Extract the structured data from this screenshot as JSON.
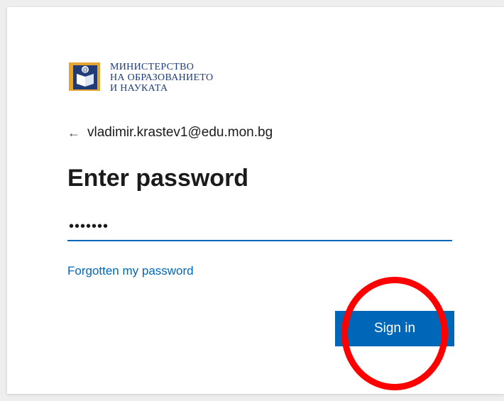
{
  "logo": {
    "line1": "МИНИСТЕРСТВО",
    "line2": "НА ОБРАЗОВАНИЕТО",
    "line3": "И НАУКАТА",
    "emblem_char": "@"
  },
  "identity": {
    "back_icon": "←",
    "email": "vladimir.krastev1@edu.mon.bg"
  },
  "title": "Enter password",
  "password": {
    "value": "•••••••"
  },
  "links": {
    "forgot": "Forgotten my password"
  },
  "buttons": {
    "sign_in": "Sign in"
  },
  "colors": {
    "accent": "#0067b8",
    "annotation": "#ff0000",
    "logo_blue": "#1f3c78",
    "logo_gold": "#e3a635"
  }
}
